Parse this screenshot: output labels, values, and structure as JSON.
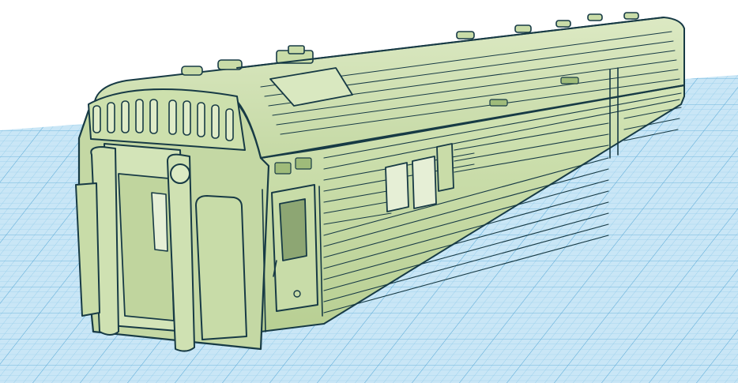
{
  "app": {
    "name": "",
    "view": "3d-workplane"
  },
  "colors": {
    "background": "#ffffff",
    "grid_base": "#c9e6f6",
    "grid_minor": "#8ecae9",
    "grid_major": "#5aa9d6",
    "model_fill": "#c4d8a4",
    "model_fill_light": "#d6e6ba",
    "model_fill_dark": "#a9c283",
    "model_outline": "#173a45",
    "glass": "#8da673"
  },
  "model": {
    "name": "",
    "type": "passenger-railcar-shell"
  }
}
